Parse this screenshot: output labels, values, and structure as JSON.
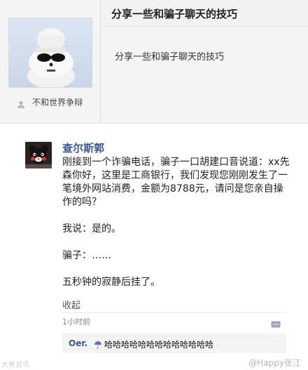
{
  "card": {
    "title": "分享一些和骗子聊天的技巧",
    "description": "分享一些和骗子聊天的技巧",
    "profile_name": "不和世界争辩"
  },
  "post": {
    "author": "查尔斯郭",
    "body": "刚接到一个诈骗电话，骗子一口胡建口音说道：xx先森你好，这里是工商银行，我们发现您刚刚发生了一笔境外网站消费，金额为8788元，请问是您亲自操作的吗？\n\n我说：是的。\n\n骗子：……\n\n五秒钟的寂静后挂了。",
    "collapse": "收起",
    "time": "1小时前"
  },
  "comment": {
    "user": "Oer.",
    "text": "哈哈哈哈哈哈哈哈哈哈哈哈哈"
  },
  "watermark": {
    "left": "大蕉资讯",
    "right": "@Happy张江"
  },
  "icons": {
    "user": "user-icon",
    "comment": "comment-icon",
    "emoji": "umbrella-emoji"
  },
  "colors": {
    "link_blue": "#3a5893",
    "background": "#ffffff",
    "card_bg": "#f4f4f4"
  }
}
